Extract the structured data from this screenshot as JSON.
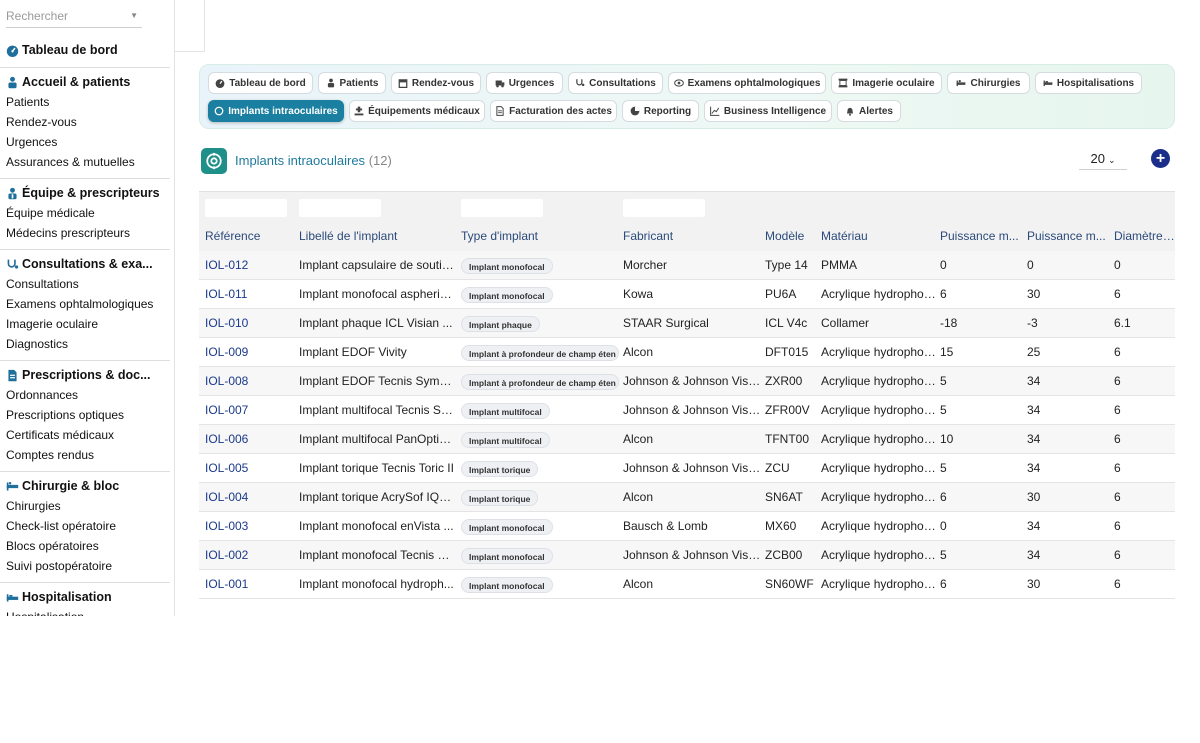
{
  "sidebar": {
    "search_placeholder": "Rechercher",
    "dashboard": "Tableau de bord",
    "sections": [
      {
        "title": "Accueil & patients",
        "items": [
          "Patients",
          "Rendez-vous",
          "Urgences",
          "Assurances & mutuelles"
        ]
      },
      {
        "title": "Équipe & prescripteurs",
        "items": [
          "Équipe médicale",
          "Médecins prescripteurs"
        ]
      },
      {
        "title": "Consultations & exa...",
        "items": [
          "Consultations",
          "Examens ophtalmologiques",
          "Imagerie oculaire",
          "Diagnostics"
        ]
      },
      {
        "title": "Prescriptions & doc...",
        "items": [
          "Ordonnances",
          "Prescriptions optiques",
          "Certificats médicaux",
          "Comptes rendus"
        ]
      },
      {
        "title": "Chirurgie & bloc",
        "items": [
          "Chirurgies",
          "Check-list opératoire",
          "Blocs opératoires",
          "Suivi postopératoire"
        ]
      },
      {
        "title": "Hospitalisation",
        "items": [
          "Hospitalisation"
        ]
      }
    ]
  },
  "nav": {
    "row1": [
      "Tableau de bord",
      "Patients",
      "Rendez-vous",
      "Urgences",
      "Consultations",
      "Examens ophtalmologiques",
      "Imagerie oculaire",
      "Chirurgies",
      "Hospitalisations"
    ],
    "row2": [
      "Implants intraoculaires",
      "Équipements médicaux",
      "Facturation des actes",
      "Reporting",
      "Business Intelligence",
      "Alertes"
    ]
  },
  "header": {
    "title": "Implants intraoculaires",
    "count": "(12)",
    "per_page": "20",
    "add_symbol": "+"
  },
  "table": {
    "columns": [
      "Référence",
      "Libellé de l'implant",
      "Type d'implant",
      "Fabricant",
      "Modèle",
      "Matériau",
      "Puissance m...",
      "Puissance m...",
      "Diamètre op"
    ],
    "rows": [
      [
        "IOL-012",
        "Implant capsulaire de soutie...",
        "Implant monofocal",
        "Morcher",
        "Type 14",
        "PMMA",
        "0",
        "0",
        "0"
      ],
      [
        "IOL-011",
        "Implant monofocal aspheriq...",
        "Implant monofocal",
        "Kowa",
        "PU6A",
        "Acrylique hydrophobe",
        "6",
        "30",
        "6"
      ],
      [
        "IOL-010",
        "Implant phaque ICL Visian ...",
        "Implant phaque",
        "STAAR Surgical",
        "ICL V4c",
        "Collamer",
        "-18",
        "-3",
        "6.1"
      ],
      [
        "IOL-009",
        "Implant EDOF Vivity",
        "Implant à profondeur de champ éten",
        "Alcon",
        "DFT015",
        "Acrylique hydrophobe",
        "15",
        "25",
        "6"
      ],
      [
        "IOL-008",
        "Implant EDOF Tecnis Symfo...",
        "Implant à profondeur de champ éten",
        "Johnson & Johnson Vision",
        "ZXR00",
        "Acrylique hydrophobe",
        "5",
        "34",
        "6"
      ],
      [
        "IOL-007",
        "Implant multifocal Tecnis Sy...",
        "Implant multifocal",
        "Johnson & Johnson Vision",
        "ZFR00V",
        "Acrylique hydrophobe",
        "5",
        "34",
        "6"
      ],
      [
        "IOL-006",
        "Implant multifocal PanOptix ...",
        "Implant multifocal",
        "Alcon",
        "TFNT00",
        "Acrylique hydrophobe",
        "10",
        "34",
        "6"
      ],
      [
        "IOL-005",
        "Implant torique Tecnis Toric II",
        "Implant torique",
        "Johnson & Johnson Vision",
        "ZCU",
        "Acrylique hydrophobe",
        "5",
        "34",
        "6"
      ],
      [
        "IOL-004",
        "Implant torique AcrySof IQ T...",
        "Implant torique",
        "Alcon",
        "SN6AT",
        "Acrylique hydrophobe",
        "6",
        "30",
        "6"
      ],
      [
        "IOL-003",
        "Implant monofocal enVista ...",
        "Implant monofocal",
        "Bausch & Lomb",
        "MX60",
        "Acrylique hydrophobe",
        "0",
        "34",
        "6"
      ],
      [
        "IOL-002",
        "Implant monofocal Tecnis Z...",
        "Implant monofocal",
        "Johnson & Johnson Vision",
        "ZCB00",
        "Acrylique hydrophobe",
        "5",
        "34",
        "6"
      ],
      [
        "IOL-001",
        "Implant monofocal hydroph...",
        "Implant monofocal",
        "Alcon",
        "SN60WF",
        "Acrylique hydrophobe",
        "6",
        "30",
        "6"
      ]
    ]
  },
  "colors": {
    "accent": "#1a7fa0",
    "title": "#1f7a9c",
    "link": "#1a3a8a",
    "add_button": "#1a2e8a"
  }
}
